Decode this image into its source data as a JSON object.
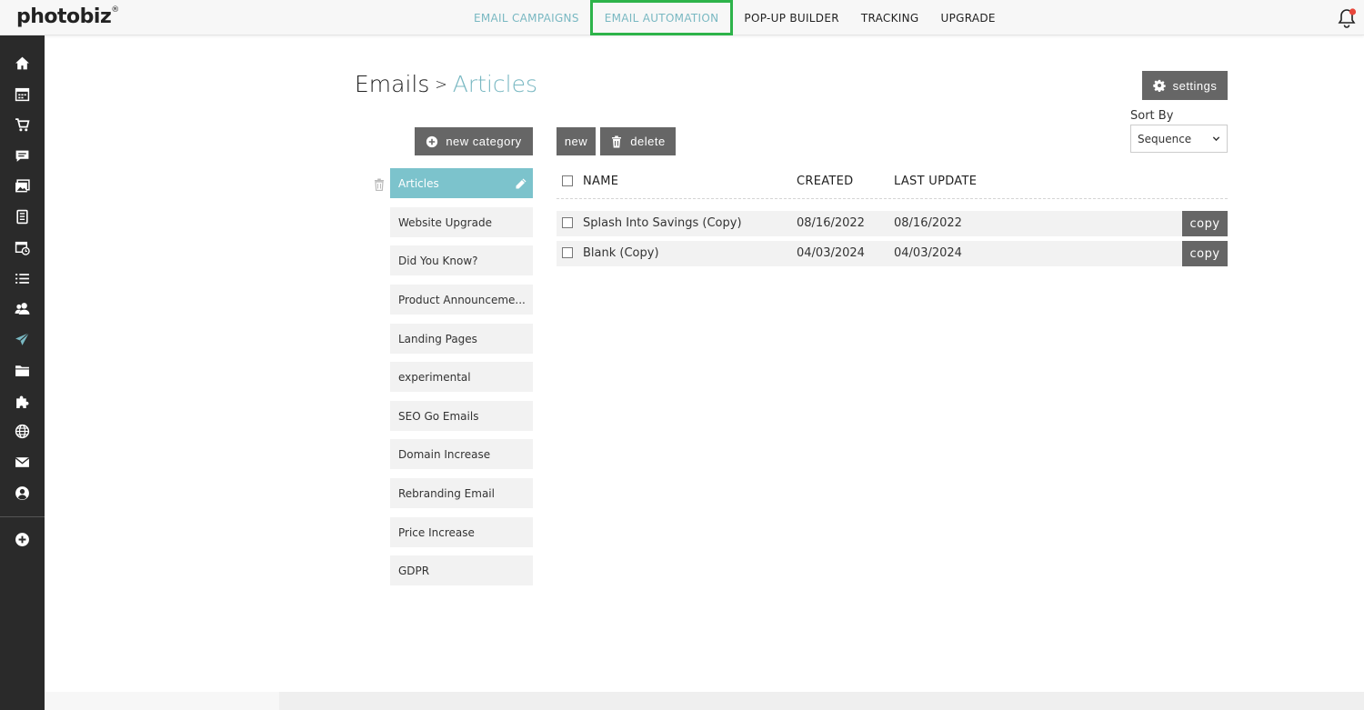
{
  "brand": {
    "logo": "photobiz",
    "mark": "®"
  },
  "topnav": [
    {
      "label": "EMAIL CAMPAIGNS"
    },
    {
      "label": "EMAIL AUTOMATION"
    },
    {
      "label": "POP-UP BUILDER"
    },
    {
      "label": "TRACKING"
    },
    {
      "label": "UPGRADE"
    }
  ],
  "sidebar_icons": [
    "home-icon",
    "calendar-icon",
    "cart-icon",
    "chat-icon",
    "images-icon",
    "document-icon",
    "schedule-icon",
    "list-icon",
    "users-icon",
    "send-icon",
    "folder-icon",
    "puzzle-icon",
    "globe-icon",
    "mail-icon",
    "account-icon",
    "add-icon"
  ],
  "header": {
    "title": "Emails",
    "separator": ">",
    "crumb": "Articles"
  },
  "settings_label": "settings",
  "new_category_label": "new category",
  "new_label": "new",
  "delete_label": "delete",
  "sort": {
    "label": "Sort By",
    "value": "Sequence"
  },
  "categories": [
    "Articles",
    "Website Upgrade",
    "Did You Know?",
    "Product Announceme...",
    "Landing Pages",
    "experimental",
    "SEO Go Emails",
    "Domain Increase",
    "Rebranding Email",
    "Price Increase",
    "GDPR"
  ],
  "table": {
    "columns": [
      "NAME",
      "CREATED",
      "LAST UPDATE"
    ],
    "rows": [
      {
        "name": "Splash Into Savings (Copy)",
        "created": "08/16/2022",
        "updated": "08/16/2022",
        "action": "copy"
      },
      {
        "name": "Blank (Copy)",
        "created": "04/03/2024",
        "updated": "04/03/2024",
        "action": "copy"
      }
    ]
  },
  "colors": {
    "accent": "#79b8c2",
    "active_category": "#7cc3cc",
    "highlight_border": "#2db34a",
    "button": "#666666",
    "sidebar": "#2a2a2a",
    "notification_dot": "#e8473b"
  }
}
